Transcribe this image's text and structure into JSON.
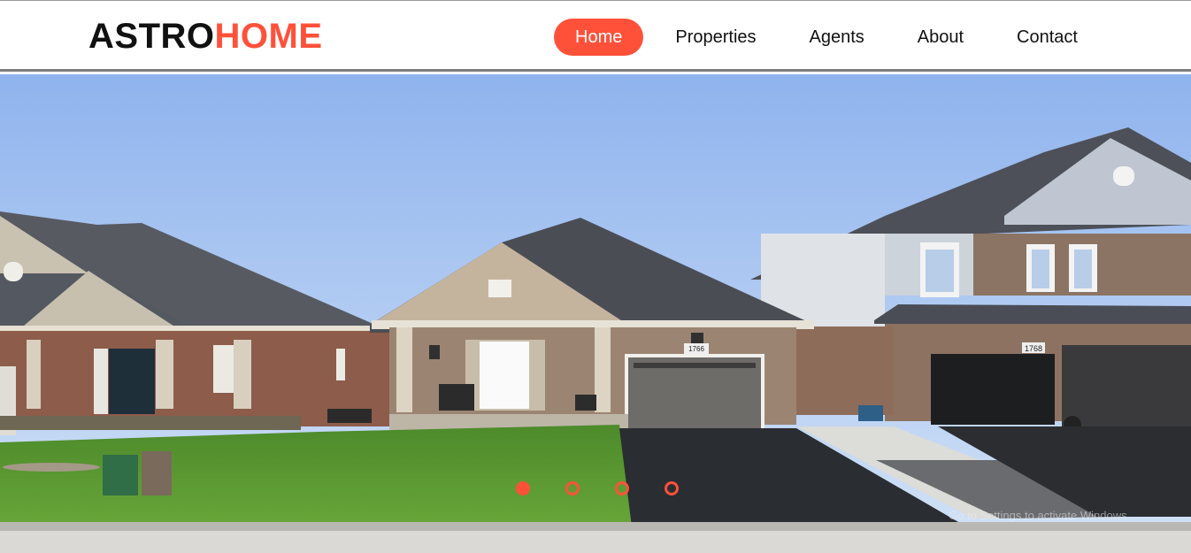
{
  "brand": {
    "part_a": "ASTRO",
    "part_b": "HOME",
    "accent_color": "#ff513a"
  },
  "nav": {
    "items": [
      {
        "label": "Home",
        "active": true
      },
      {
        "label": "Properties",
        "active": false
      },
      {
        "label": "Agents",
        "active": false
      },
      {
        "label": "About",
        "active": false
      },
      {
        "label": "Contact",
        "active": false
      }
    ]
  },
  "hero": {
    "slide_count": 4,
    "active_slide": 1,
    "house_numbers": {
      "center": "1766",
      "right": "1768"
    }
  },
  "overlay": {
    "activation_text": "Go to Settings to activate Windows."
  }
}
